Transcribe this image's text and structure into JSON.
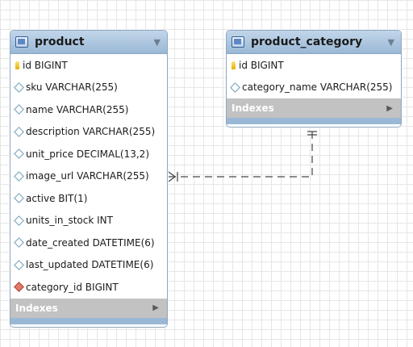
{
  "tables": {
    "product": {
      "name": "product",
      "columns": [
        {
          "text": "id BIGINT",
          "kind": "pk"
        },
        {
          "text": "sku VARCHAR(255)",
          "kind": "col"
        },
        {
          "text": "name VARCHAR(255)",
          "kind": "col"
        },
        {
          "text": "description VARCHAR(255)",
          "kind": "col"
        },
        {
          "text": "unit_price DECIMAL(13,2)",
          "kind": "col"
        },
        {
          "text": "image_url VARCHAR(255)",
          "kind": "col"
        },
        {
          "text": "active BIT(1)",
          "kind": "col"
        },
        {
          "text": "units_in_stock INT",
          "kind": "col"
        },
        {
          "text": "date_created DATETIME(6)",
          "kind": "col"
        },
        {
          "text": "last_updated DATETIME(6)",
          "kind": "col"
        },
        {
          "text": "category_id BIGINT",
          "kind": "fk"
        }
      ],
      "indexes_label": "Indexes"
    },
    "product_category": {
      "name": "product_category",
      "columns": [
        {
          "text": "id BIGINT",
          "kind": "pk"
        },
        {
          "text": "category_name VARCHAR(255)",
          "kind": "col"
        }
      ],
      "indexes_label": "Indexes"
    }
  },
  "colors": {
    "header": "#9ab8d6",
    "indexes_bar": "#c2c2c2",
    "relationship_line": "#666666"
  },
  "relationship": {
    "from": "product.category_id",
    "to": "product_category.id",
    "style": "dashed",
    "cardinality": "many-to-one"
  }
}
